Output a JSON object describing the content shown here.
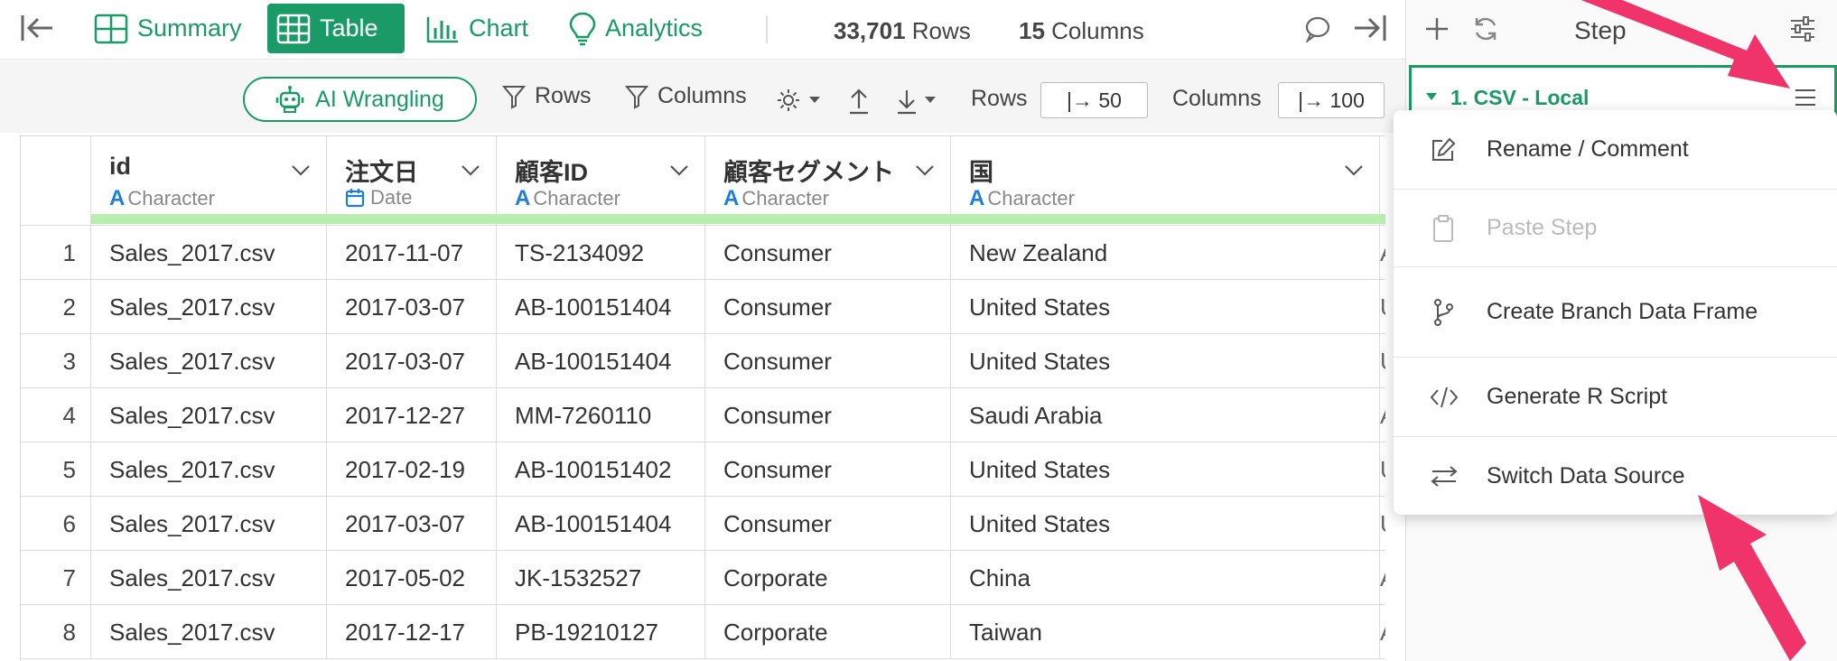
{
  "topbar": {
    "tabs": [
      {
        "label": "Summary"
      },
      {
        "label": "Table"
      },
      {
        "label": "Chart"
      },
      {
        "label": "Analytics"
      }
    ],
    "rows_count": "33,701",
    "rows_label": "Rows",
    "cols_count": "15",
    "cols_label": "Columns"
  },
  "toolbar": {
    "ai_label": "AI Wrangling",
    "rows_filter": "Rows",
    "columns_filter": "Columns",
    "rows_label": "Rows",
    "rows_value": "|→ 50",
    "columns_label": "Columns",
    "columns_value": "|→ 100"
  },
  "table": {
    "columns": [
      {
        "name": "id",
        "type": "Character"
      },
      {
        "name": "注文日",
        "type": "Date"
      },
      {
        "name": "顧客ID",
        "type": "Character"
      },
      {
        "name": "顧客セグメント",
        "type": "Character"
      },
      {
        "name": "国",
        "type": "Character"
      }
    ],
    "rows": [
      {
        "n": "1",
        "cells": [
          "Sales_2017.csv",
          "2017-11-07",
          "TS-2134092",
          "Consumer",
          "New Zealand",
          "A"
        ]
      },
      {
        "n": "2",
        "cells": [
          "Sales_2017.csv",
          "2017-03-07",
          "AB-100151404",
          "Consumer",
          "United States",
          "U"
        ]
      },
      {
        "n": "3",
        "cells": [
          "Sales_2017.csv",
          "2017-03-07",
          "AB-100151404",
          "Consumer",
          "United States",
          "U"
        ]
      },
      {
        "n": "4",
        "cells": [
          "Sales_2017.csv",
          "2017-12-27",
          "MM-7260110",
          "Consumer",
          "Saudi Arabia",
          "A"
        ]
      },
      {
        "n": "5",
        "cells": [
          "Sales_2017.csv",
          "2017-02-19",
          "AB-100151402",
          "Consumer",
          "United States",
          "U"
        ]
      },
      {
        "n": "6",
        "cells": [
          "Sales_2017.csv",
          "2017-03-07",
          "AB-100151404",
          "Consumer",
          "United States",
          "U"
        ]
      },
      {
        "n": "7",
        "cells": [
          "Sales_2017.csv",
          "2017-05-02",
          "JK-1532527",
          "Corporate",
          "China",
          "A"
        ]
      },
      {
        "n": "8",
        "cells": [
          "Sales_2017.csv",
          "2017-12-17",
          "PB-19210127",
          "Corporate",
          "Taiwan",
          "A"
        ]
      }
    ]
  },
  "rightpanel": {
    "header": "Step",
    "step_title": "1. CSV - Local"
  },
  "menu": {
    "items": [
      {
        "label": "Rename / Comment",
        "icon": "edit-icon"
      },
      {
        "label": "Paste Step",
        "icon": "clipboard-icon"
      },
      {
        "label": "Create Branch Data Frame",
        "icon": "branch-icon"
      },
      {
        "label": "Generate R Script",
        "icon": "code-icon"
      },
      {
        "label": "Switch Data Source",
        "icon": "swap-icon"
      }
    ]
  },
  "colors": {
    "accent": "#1a9a66",
    "annotation_arrow": "#f0336b",
    "type_icon": "#1e7fd6",
    "header_bar": "#b8efb0"
  }
}
